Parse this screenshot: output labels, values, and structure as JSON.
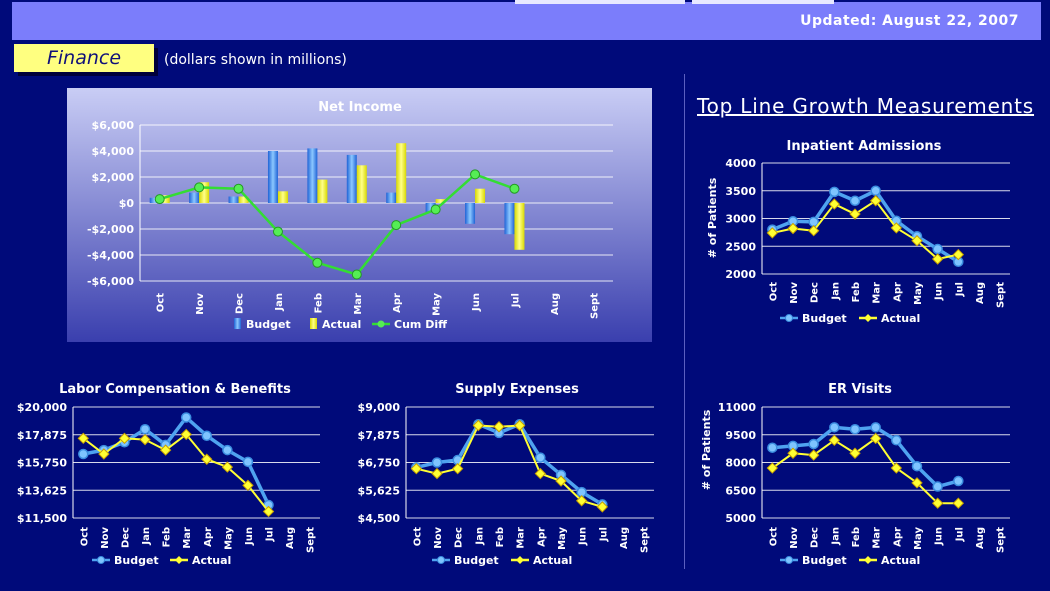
{
  "header": {
    "updated": "Updated: August 22, 2007",
    "section": "Finance",
    "note": "(dollars shown in millions)",
    "growth_title": "Top Line Growth Measurements"
  },
  "colors": {
    "background": "#000a7a",
    "topbar": "#7b7dfb",
    "budget": "#4fa3f0",
    "actual": "#ffff33",
    "cum_diff": "#33dd33"
  },
  "chart_data": [
    {
      "id": "net-income",
      "type": "bar",
      "title": "Net Income",
      "categories": [
        "Oct",
        "Nov",
        "Dec",
        "Jan",
        "Feb",
        "Mar",
        "Apr",
        "May",
        "Jun",
        "Jul",
        "Aug",
        "Sept"
      ],
      "ylim": [
        -6000,
        6000
      ],
      "yticks": [
        -6000,
        -4000,
        -2000,
        0,
        2000,
        4000,
        6000
      ],
      "ytick_labels": [
        "-$6,000",
        "-$4,000",
        "-$2,000",
        "$0",
        "$2,000",
        "$4,000",
        "$6,000"
      ],
      "series": [
        {
          "name": "Budget",
          "type": "bar",
          "values": [
            400,
            800,
            500,
            4000,
            4200,
            3700,
            800,
            -700,
            -1600,
            -2400,
            null,
            null
          ]
        },
        {
          "name": "Actual",
          "type": "bar",
          "values": [
            600,
            1600,
            500,
            900,
            1800,
            2900,
            4600,
            300,
            1100,
            -3600,
            null,
            null
          ]
        },
        {
          "name": "Cum Diff",
          "type": "line",
          "values": [
            300,
            1200,
            1100,
            -2200,
            -4600,
            -5500,
            -1700,
            -500,
            2200,
            1100,
            null,
            null
          ]
        }
      ],
      "legend": "bottom",
      "grid": true
    },
    {
      "id": "inpatient",
      "type": "line",
      "title": "Inpatient Admissions",
      "ylabel": "# of Patients",
      "categories": [
        "Oct",
        "Nov",
        "Dec",
        "Jan",
        "Feb",
        "Mar",
        "Apr",
        "May",
        "Jun",
        "Jul",
        "Aug",
        "Sept"
      ],
      "ylim": [
        2000,
        4000
      ],
      "yticks": [
        2000,
        2500,
        3000,
        3500,
        4000
      ],
      "ytick_labels": [
        "2000",
        "2500",
        "3000",
        "3500",
        "4000"
      ],
      "series": [
        {
          "name": "Budget",
          "values": [
            2800,
            2950,
            2940,
            3480,
            3320,
            3500,
            2960,
            2680,
            2450,
            2220,
            null,
            null
          ]
        },
        {
          "name": "Actual",
          "values": [
            2740,
            2820,
            2780,
            3260,
            3080,
            3320,
            2830,
            2600,
            2270,
            2350,
            null,
            null
          ]
        }
      ],
      "legend": "bottom",
      "grid": true
    },
    {
      "id": "labor",
      "type": "line",
      "title": "Labor Compensation & Benefits",
      "categories": [
        "Oct",
        "Nov",
        "Dec",
        "Jan",
        "Feb",
        "Mar",
        "Apr",
        "May",
        "Jun",
        "Jul",
        "Aug",
        "Sept"
      ],
      "ylim": [
        11500,
        20000
      ],
      "yticks": [
        11500,
        13625,
        15750,
        17875,
        20000
      ],
      "ytick_labels": [
        "$11,500",
        "$13,625",
        "$15,750",
        "$17,875",
        "$20,000"
      ],
      "series": [
        {
          "name": "Budget",
          "values": [
            16400,
            16700,
            17300,
            18300,
            17100,
            19200,
            17800,
            16700,
            15800,
            12500,
            null,
            null
          ]
        },
        {
          "name": "Actual",
          "values": [
            17600,
            16400,
            17600,
            17500,
            16700,
            17900,
            16000,
            15400,
            14000,
            12000,
            null,
            null
          ]
        }
      ],
      "legend": "bottom",
      "grid": true
    },
    {
      "id": "supply",
      "type": "line",
      "title": "Supply Expenses",
      "categories": [
        "Oct",
        "Nov",
        "Dec",
        "Jan",
        "Feb",
        "Mar",
        "Apr",
        "May",
        "Jun",
        "Jul",
        "Aug",
        "Sept"
      ],
      "ylim": [
        4500,
        9000
      ],
      "yticks": [
        4500,
        5625,
        6750,
        7875,
        9000
      ],
      "ytick_labels": [
        "$4,500",
        "$5,625",
        "$6,750",
        "$7,875",
        "$9,000"
      ],
      "series": [
        {
          "name": "Budget",
          "values": [
            6550,
            6750,
            6850,
            8300,
            7950,
            8300,
            6950,
            6250,
            5550,
            5050,
            null,
            null
          ]
        },
        {
          "name": "Actual",
          "values": [
            6500,
            6300,
            6500,
            8250,
            8200,
            8250,
            6300,
            6000,
            5200,
            4950,
            null,
            null
          ]
        }
      ],
      "legend": "bottom",
      "grid": true
    },
    {
      "id": "er",
      "type": "line",
      "title": "ER Visits",
      "ylabel": "# of Patients",
      "categories": [
        "Oct",
        "Nov",
        "Dec",
        "Jan",
        "Feb",
        "Mar",
        "Apr",
        "May",
        "Jun",
        "Jul",
        "Aug",
        "Sept"
      ],
      "ylim": [
        5000,
        11000
      ],
      "yticks": [
        5000,
        6500,
        8000,
        9500,
        11000
      ],
      "ytick_labels": [
        "5000",
        "6500",
        "8000",
        "9500",
        "11000"
      ],
      "series": [
        {
          "name": "Budget",
          "values": [
            8800,
            8900,
            9000,
            9900,
            9800,
            9900,
            9200,
            7800,
            6700,
            7000,
            null,
            null
          ]
        },
        {
          "name": "Actual",
          "values": [
            7700,
            8500,
            8400,
            9200,
            8500,
            9300,
            7700,
            6900,
            5800,
            5800,
            null,
            null
          ]
        }
      ],
      "legend": "bottom",
      "grid": true
    }
  ]
}
